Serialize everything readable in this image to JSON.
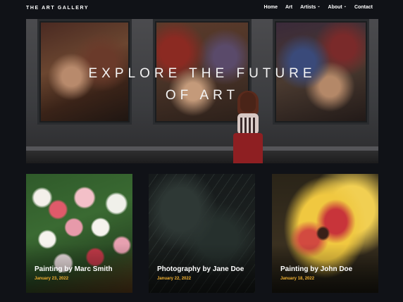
{
  "header": {
    "brand": "THE ART GALLERY",
    "nav": [
      {
        "label": "Home"
      },
      {
        "label": "Art"
      },
      {
        "label": "Artists",
        "has_dropdown": true
      },
      {
        "label": "About",
        "has_dropdown": true
      },
      {
        "label": "Contact"
      }
    ]
  },
  "hero": {
    "title_line1": "EXPLORE THE FUTURE",
    "title_line2": "OF ART"
  },
  "cards": [
    {
      "title": "Painting by Marc Smith",
      "date": "January 23, 2022"
    },
    {
      "title": "Photography by Jane Doe",
      "date": "January 22, 2022"
    },
    {
      "title": "Painting by John Doe",
      "date": "January 18, 2022"
    }
  ],
  "colors": {
    "background": "#101217",
    "date_accent": "#f2b233",
    "text": "#ffffff"
  }
}
